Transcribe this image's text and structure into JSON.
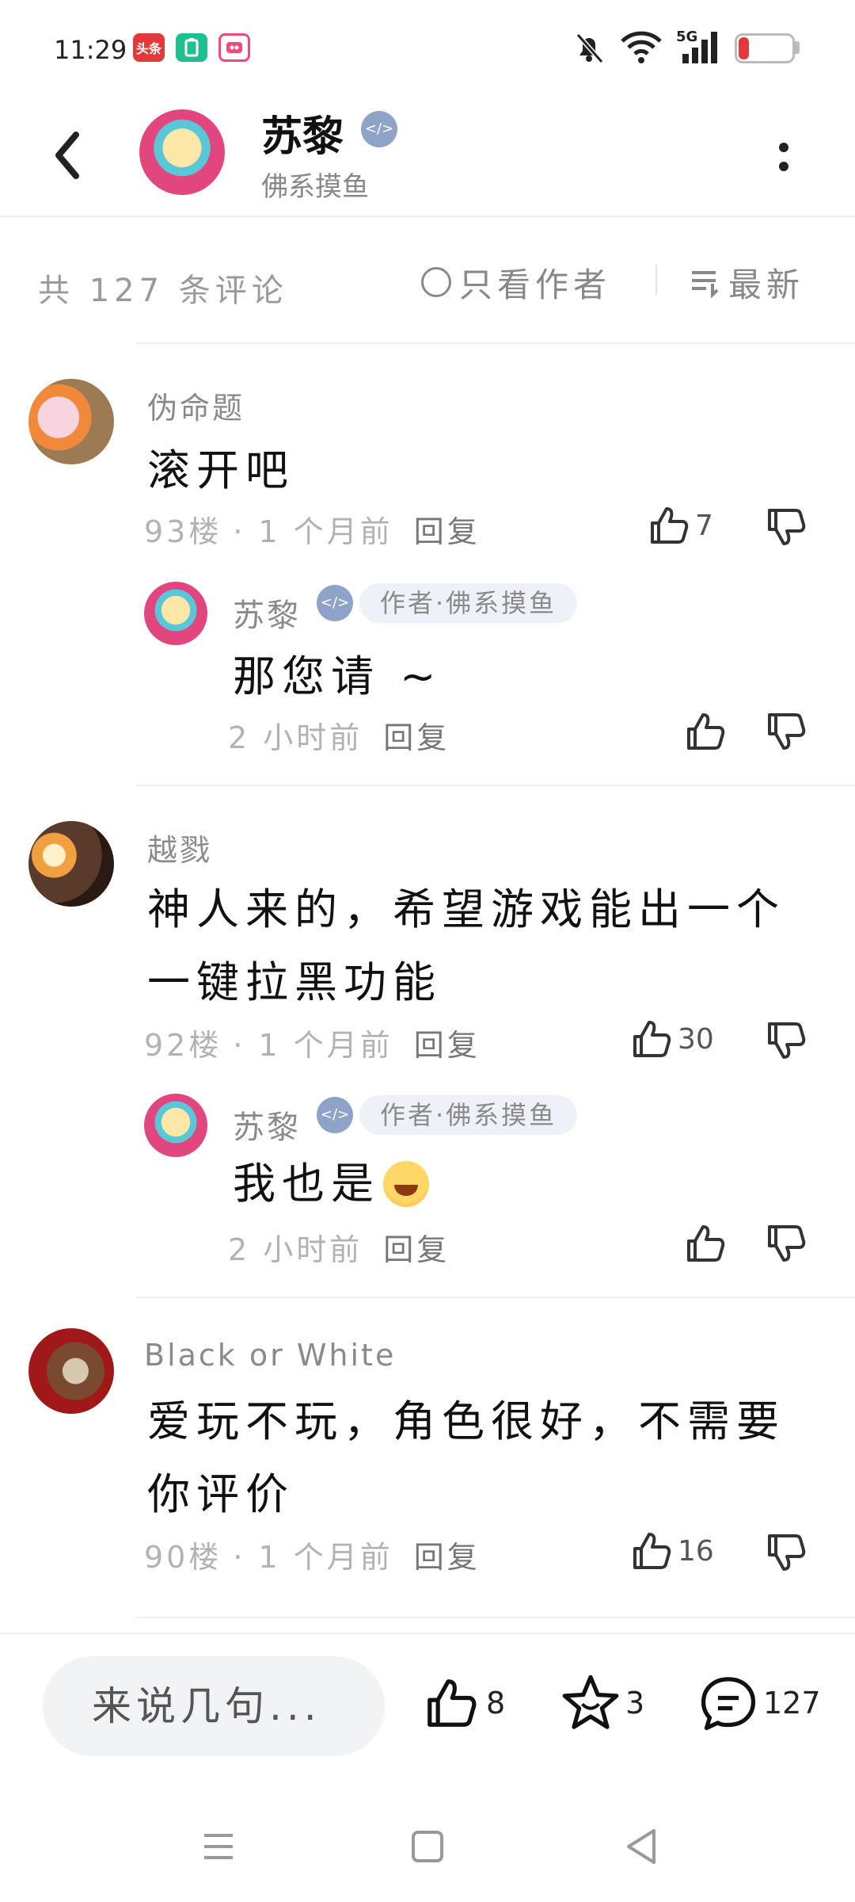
{
  "status_bar": {
    "time": "11:29",
    "apps": [
      {
        "icon": "toutiao-icon",
        "label": "头条",
        "color": "#e03a3a"
      },
      {
        "icon": "battery-app-icon",
        "color": "#1fbf8f"
      },
      {
        "icon": "video-app-icon",
        "color": "#f04a7a"
      }
    ],
    "network": "5G",
    "battery": 19,
    "battery_label": "19"
  },
  "header": {
    "author_name": "苏黎",
    "author_subtitle": "佛系摸鱼",
    "badge_icon": "game-controller-icon"
  },
  "toolbar": {
    "comment_count_label": "共 127 条评论",
    "only_author_label": "只看作者",
    "sort_label": "最新"
  },
  "comments": [
    {
      "name": "伪命题",
      "text_lines": [
        "滚开吧"
      ],
      "floor": "93楼",
      "time": "· 1 个月前",
      "reply_label": "回复",
      "likes": "7",
      "reply": {
        "name": "苏黎",
        "tag": "作者·佛系摸鱼",
        "text": "那您请 ~",
        "time": "2 小时前",
        "reply_label": "回复"
      }
    },
    {
      "name": "越戮",
      "text_lines": [
        "神人来的，希望游戏能出一个",
        "一键拉黑功能"
      ],
      "floor": "92楼",
      "time": "· 1 个月前",
      "reply_label": "回复",
      "likes": "30",
      "reply": {
        "name": "苏黎",
        "tag": "作者·佛系摸鱼",
        "text": "我也是",
        "emoji": "grinning-face-emoji",
        "time": "2 小时前",
        "reply_label": "回复"
      }
    },
    {
      "name": "Black or White",
      "text_lines": [
        "爱玩不玩，角色很好，不需要",
        "你评价"
      ],
      "floor": "90楼",
      "time": "· 1 个月前",
      "reply_label": "回复",
      "likes": "16"
    }
  ],
  "bottom_bar": {
    "input_placeholder": "来说几句...",
    "like_count": "8",
    "favorite_count": "3",
    "comment_count": "127"
  },
  "colors": {
    "accent_gray": "#888888",
    "battery_low": "#e03a3a",
    "tag_bg": "#eef1f7"
  }
}
